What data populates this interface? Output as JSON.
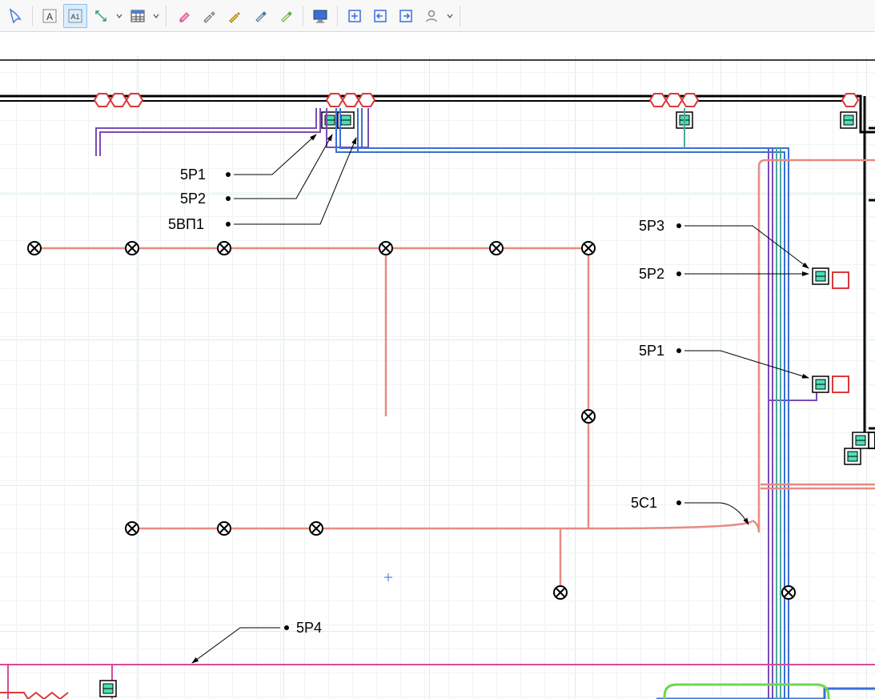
{
  "toolbar": {
    "select_tool": "select",
    "text_a_tool": "text-a",
    "text_a1_tool": "text-a1",
    "dimension_tool": "dimension",
    "table_tool": "table",
    "eraser_tool": "eraser",
    "eyedropper_tool": "eyedropper",
    "pencil_tool": "pencil",
    "marker_tool": "marker",
    "monitor_tool": "monitor",
    "import_tool": "import",
    "box_left_tool": "box-left",
    "box_right_tool": "box-right",
    "user_tool": "user"
  },
  "labels": {
    "l1": "5Р1",
    "l2": "5Р2",
    "l3": "5ВП1",
    "l4": "5Р3",
    "l5": "5Р2",
    "l6": "5Р1",
    "l7": "5С1",
    "l8": "5Р4"
  },
  "colors": {
    "salmon": "#e88b83",
    "purple": "#7a4db3",
    "blue": "#3a6fd8",
    "teal": "#4ba89e",
    "magenta": "#d84a9a",
    "red": "#d83a3a",
    "black": "#000000",
    "lime": "#6ed84a"
  }
}
